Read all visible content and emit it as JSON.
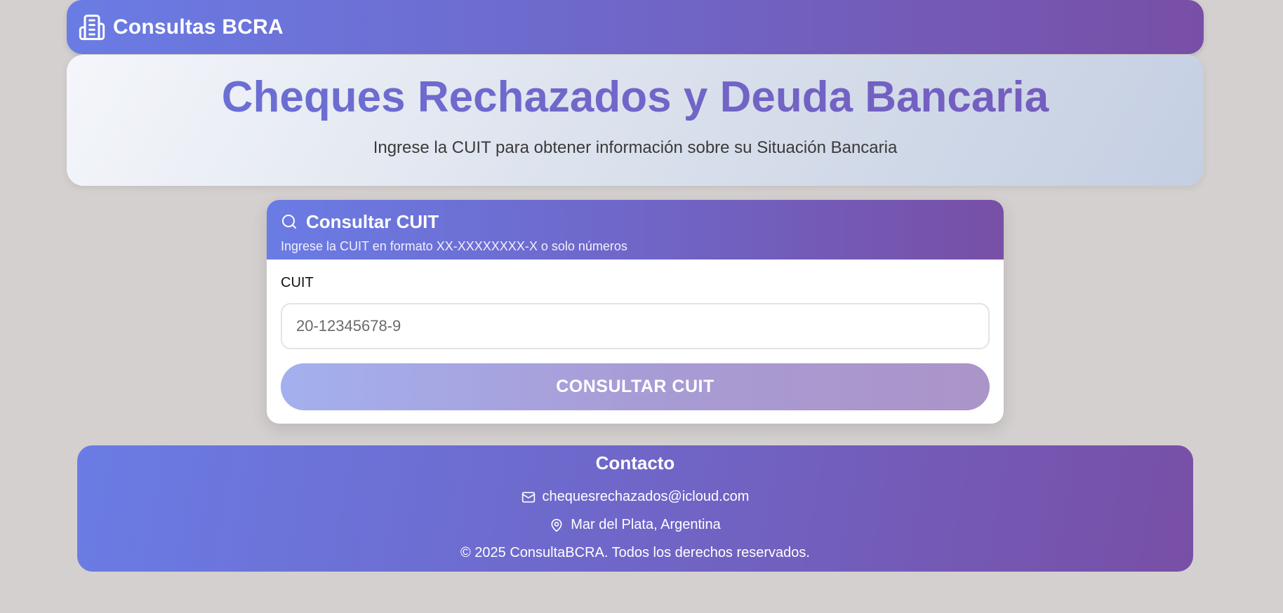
{
  "navbar": {
    "brand_icon": "building-icon",
    "brand_text": "Consultas BCRA"
  },
  "hero": {
    "title": "Cheques Rechazados y Deuda Bancaria",
    "subtitle": "Ingrese la CUIT para obtener información sobre su Situación Bancaria"
  },
  "card": {
    "icon": "search-icon",
    "title": "Consultar CUIT",
    "subtitle": "Ingrese la CUIT en formato XX-XXXXXXXX-X o solo números",
    "field_label": "CUIT",
    "input_placeholder": "20-12345678-9",
    "input_value": "",
    "button_label": "CONSULTAR CUIT"
  },
  "footer": {
    "title": "Contacto",
    "email_icon": "mail-icon",
    "email": "chequesrechazados@icloud.com",
    "location_icon": "map-pin-icon",
    "location": "Mar del Plata, Argentina",
    "copyright": "© 2025 ConsultaBCRA. Todos los derechos reservados."
  },
  "colors": {
    "background": "#d4d0cf",
    "gradient_start": "#6a7ce4",
    "gradient_end": "#784fa6",
    "button_disabled_start": "#a4b0ee",
    "button_disabled_end": "#ab94c8"
  }
}
